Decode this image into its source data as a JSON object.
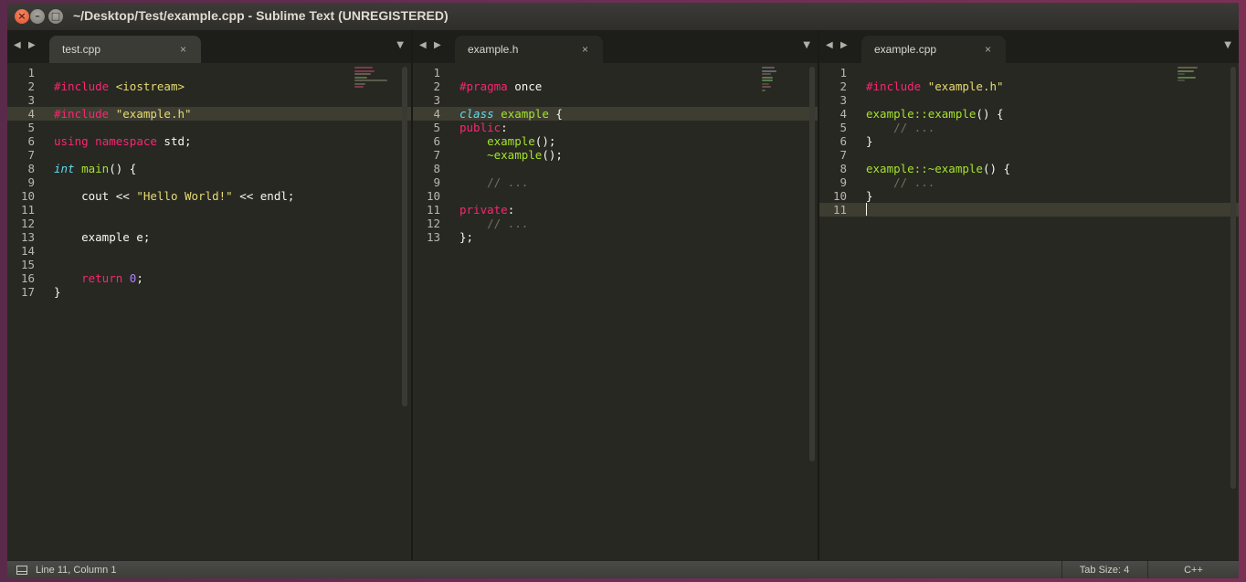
{
  "window": {
    "title": "~/Desktop/Test/example.cpp - Sublime Text (UNREGISTERED)",
    "close_glyph": "×",
    "min_glyph": "–",
    "max_glyph": "□"
  },
  "panes": [
    {
      "tab_label": "test.cpp",
      "current_line": 4,
      "lines": [
        {
          "n": "1",
          "html": ""
        },
        {
          "n": "2",
          "html": "<span class=\"pp\">#include</span> <span class=\"st\">&lt;iostream&gt;</span>"
        },
        {
          "n": "3",
          "html": ""
        },
        {
          "n": "4",
          "html": "<span class=\"pp\">#include</span> <span class=\"st\">\"example.h\"</span>"
        },
        {
          "n": "5",
          "html": ""
        },
        {
          "n": "6",
          "html": "<span class=\"kw\">using</span> <span class=\"kw\">namespace</span> std;"
        },
        {
          "n": "7",
          "html": ""
        },
        {
          "n": "8",
          "html": "<span class=\"ty\">int</span> <span class=\"fn\">main</span>() {"
        },
        {
          "n": "9",
          "html": ""
        },
        {
          "n": "10",
          "html": "    cout &lt;&lt; <span class=\"st\">\"Hello World!\"</span> &lt;&lt; endl;"
        },
        {
          "n": "11",
          "html": ""
        },
        {
          "n": "12",
          "html": ""
        },
        {
          "n": "13",
          "html": "    example e;"
        },
        {
          "n": "14",
          "html": ""
        },
        {
          "n": "15",
          "html": ""
        },
        {
          "n": "16",
          "html": "    <span class=\"kw\">return</span> <span class=\"nu\">0</span>;"
        },
        {
          "n": "17",
          "html": "}"
        }
      ]
    },
    {
      "tab_label": "example.h",
      "current_line": 4,
      "lines": [
        {
          "n": "1",
          "html": ""
        },
        {
          "n": "2",
          "html": "<span class=\"pp\">#pragma</span> once"
        },
        {
          "n": "3",
          "html": ""
        },
        {
          "n": "4",
          "html": "<span class=\"ty\">class</span> <span class=\"fn\">example</span> {"
        },
        {
          "n": "5",
          "html": "<span class=\"kw\">public</span>:"
        },
        {
          "n": "6",
          "html": "    <span class=\"fn\">example</span>();"
        },
        {
          "n": "7",
          "html": "    <span class=\"fn\">~example</span>();"
        },
        {
          "n": "8",
          "html": ""
        },
        {
          "n": "9",
          "html": "    <span class=\"cm\">// ...</span>"
        },
        {
          "n": "10",
          "html": ""
        },
        {
          "n": "11",
          "html": "<span class=\"kw\">private</span>:"
        },
        {
          "n": "12",
          "html": "    <span class=\"cm\">// ...</span>"
        },
        {
          "n": "13",
          "html": "};"
        }
      ]
    },
    {
      "tab_label": "example.cpp",
      "current_line": 11,
      "lines": [
        {
          "n": "1",
          "html": ""
        },
        {
          "n": "2",
          "html": "<span class=\"pp\">#include</span> <span class=\"st\">\"example.h\"</span>"
        },
        {
          "n": "3",
          "html": ""
        },
        {
          "n": "4",
          "html": "<span class=\"fn\">example::example</span>() {"
        },
        {
          "n": "5",
          "html": "    <span class=\"cm\">// ...</span>"
        },
        {
          "n": "6",
          "html": "}"
        },
        {
          "n": "7",
          "html": ""
        },
        {
          "n": "8",
          "html": "<span class=\"fn\">example::~example</span>() {"
        },
        {
          "n": "9",
          "html": "    <span class=\"cm\">// ...</span>"
        },
        {
          "n": "10",
          "html": "}"
        },
        {
          "n": "11",
          "html": ""
        }
      ]
    }
  ],
  "tab_close_glyph": "×",
  "nav_left_glyph": "◀",
  "nav_right_glyph": "▶",
  "tab_menu_glyph": "▼",
  "status": {
    "position": "Line 11, Column 1",
    "tab_size": "Tab Size: 4",
    "syntax": "C++"
  }
}
